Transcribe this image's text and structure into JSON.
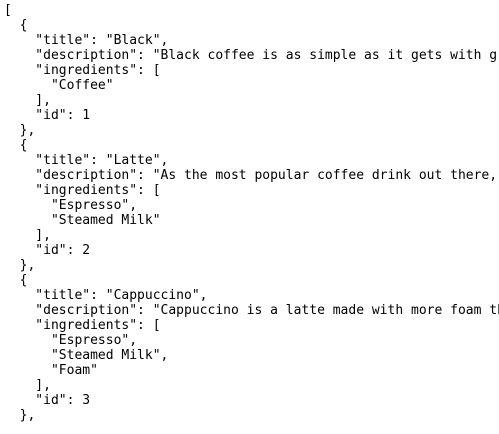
{
  "json_view": {
    "lines": [
      "[",
      "  {",
      "    \"title\": \"Black\",",
      "    \"description\": \"Black coffee is as simple as it gets with gr",
      "    \"ingredients\": [",
      "      \"Coffee\"",
      "    ],",
      "    \"id\": 1",
      "  },",
      "  {",
      "    \"title\": \"Latte\",",
      "    \"description\": \"As the most popular coffee drink out there,",
      "    \"ingredients\": [",
      "      \"Espresso\",",
      "      \"Steamed Milk\"",
      "    ],",
      "    \"id\": 2",
      "  },",
      "  {",
      "    \"title\": \"Cappuccino\",",
      "    \"description\": \"Cappuccino is a latte made with more foam th",
      "    \"ingredients\": [",
      "      \"Espresso\",",
      "      \"Steamed Milk\",",
      "      \"Foam\"",
      "    ],",
      "    \"id\": 3",
      "  },"
    ]
  }
}
